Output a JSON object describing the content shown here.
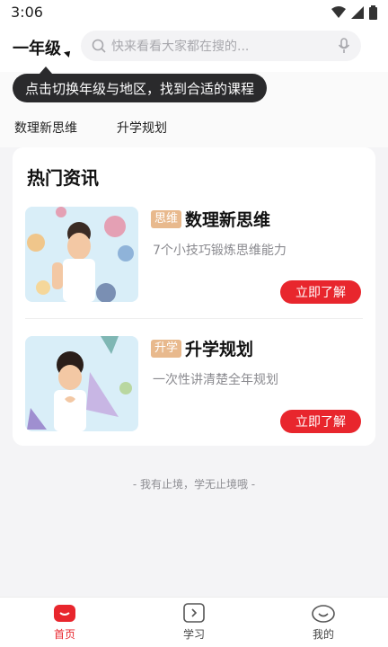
{
  "status_bar": {
    "time": "3:06"
  },
  "header": {
    "grade": "一年级",
    "search_placeholder": "快来看看大家都在搜的..."
  },
  "tooltip": {
    "text": "点击切换年级与地区，找到合适的课程"
  },
  "quick_nav": [
    "数理新思维",
    "升学规划"
  ],
  "hot_news": {
    "title": "热门资讯",
    "items": [
      {
        "tag": "思维",
        "title": "数理新思维",
        "desc": "7个小技巧锻炼思维能力",
        "button": "立即了解"
      },
      {
        "tag": "升学",
        "title": "升学规划",
        "desc": "一次性讲清楚全年规划",
        "button": "立即了解"
      }
    ]
  },
  "slogan": "- 我有止境，学无止境哦 -",
  "bottom_nav": [
    {
      "label": "首页",
      "icon": "home-icon",
      "active": true
    },
    {
      "label": "学习",
      "icon": "play-icon",
      "active": false
    },
    {
      "label": "我的",
      "icon": "profile-icon",
      "active": false
    }
  ],
  "colors": {
    "accent": "#e8262d",
    "tag": "#e8b98d"
  }
}
